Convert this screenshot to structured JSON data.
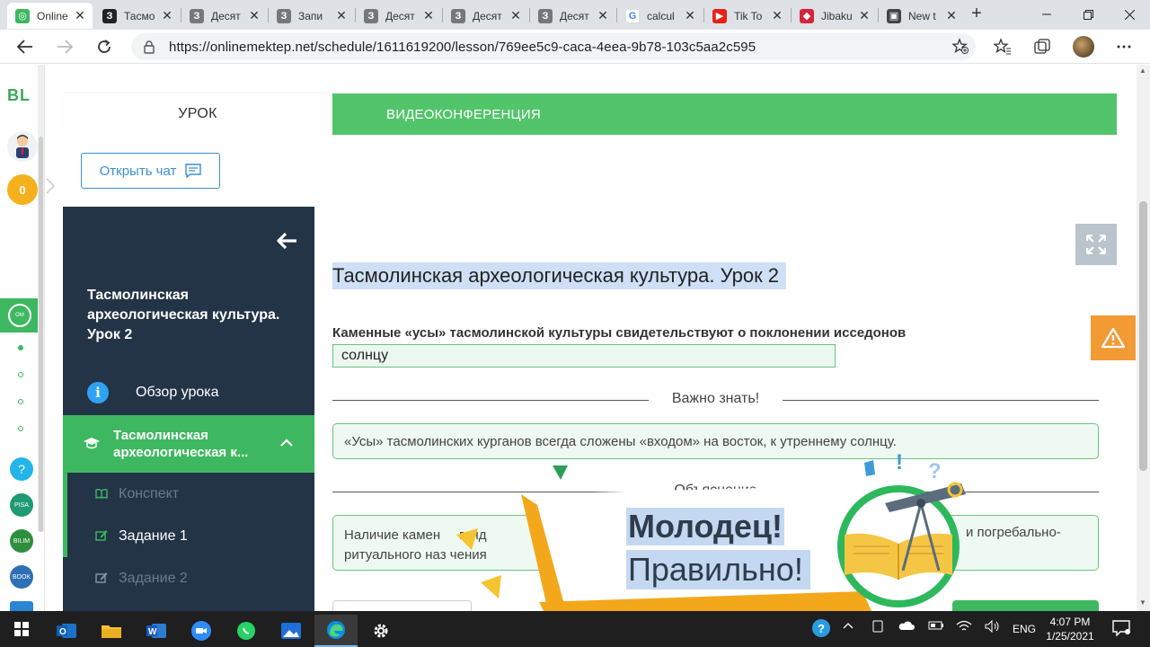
{
  "browser": {
    "tabs": [
      {
        "title": "Online",
        "favicon": "onlinemektep-icon",
        "fav_color": "#3db860",
        "fav_glyph": "◎",
        "active": true
      },
      {
        "title": "Тасмо",
        "favicon": "3-icon",
        "fav_color": "#222222",
        "fav_glyph": "З"
      },
      {
        "title": "Десят",
        "favicon": "3-icon",
        "fav_color": "#777777",
        "fav_glyph": "З"
      },
      {
        "title": "Запи",
        "favicon": "3-icon",
        "fav_color": "#777777",
        "fav_glyph": "З"
      },
      {
        "title": "Десят",
        "favicon": "3-icon",
        "fav_color": "#777777",
        "fav_glyph": "З"
      },
      {
        "title": "Десят",
        "favicon": "3-icon",
        "fav_color": "#777777",
        "fav_glyph": "З"
      },
      {
        "title": "Десят",
        "favicon": "3-icon",
        "fav_color": "#777777",
        "fav_glyph": "З"
      },
      {
        "title": "calcul",
        "favicon": "google-icon",
        "fav_color": "#ffffff",
        "fav_glyph": "G"
      },
      {
        "title": "Tik To",
        "favicon": "youtube-icon",
        "fav_color": "#e62117",
        "fav_glyph": "▶"
      },
      {
        "title": "Jibaku",
        "favicon": "shield-icon",
        "fav_color": "#d3263b",
        "fav_glyph": "◆"
      },
      {
        "title": "New t",
        "favicon": "newtab-icon",
        "fav_color": "#444444",
        "fav_glyph": "▣"
      }
    ],
    "url": "https://onlinemektep.net/schedule/1611619200/lesson/769ee5c9-caca-4eea-9b78-103c5aa2c595"
  },
  "rail": {
    "logo": "BL",
    "coins": "0"
  },
  "lesson": {
    "tab_lesson": "УРОК",
    "tab_video": "ВИДЕОКОНФЕРЕНЦИЯ",
    "chat_button": "Открыть чат",
    "side_title": "Тасмолинская археологическая культура. Урок 2",
    "nav_overview": "Обзор урока",
    "nav_topic": "Тасмолинская археологическая к...",
    "nav_items": [
      {
        "label": "Конспект",
        "color": "#6b7b8c",
        "icon_color": "#3db860"
      },
      {
        "label": "Задание 1",
        "color": "#ffffff",
        "icon_color": "#3db860"
      },
      {
        "label": "Задание 2",
        "color": "#6b7b8c",
        "icon_color": "#8a97a6"
      }
    ]
  },
  "content": {
    "title": "Тасмолинская археологическая культура. Урок 2",
    "question": "Каменные «усы» тасмолинской культуры свидетельствуют о поклонении исседонов",
    "answer": "солнцу",
    "important_label": "Важно знать!",
    "important_text": "«Усы» тасмолинских курганов всегда сложены «входом» на восток, к утреннему солнцу.",
    "explanation_label": "Объяснение",
    "explanation_text_left_1": "Наличие камен",
    "explanation_text_left_1b": "гряд",
    "explanation_text_left_2": "ритуального наз",
    "explanation_text_left_2b": "чения",
    "explanation_text_right": "и погребально-"
  },
  "celebration": {
    "title": "Молодец!",
    "subtitle": "Правильно!"
  },
  "taskbar": {
    "lang": "ENG",
    "time": "4:07 PM",
    "date": "1/25/2021"
  },
  "colors": {
    "brand_green": "#3db860",
    "nav_dark": "#233447",
    "accent_blue": "#3d8fd0",
    "warning_orange": "#f29a34"
  }
}
